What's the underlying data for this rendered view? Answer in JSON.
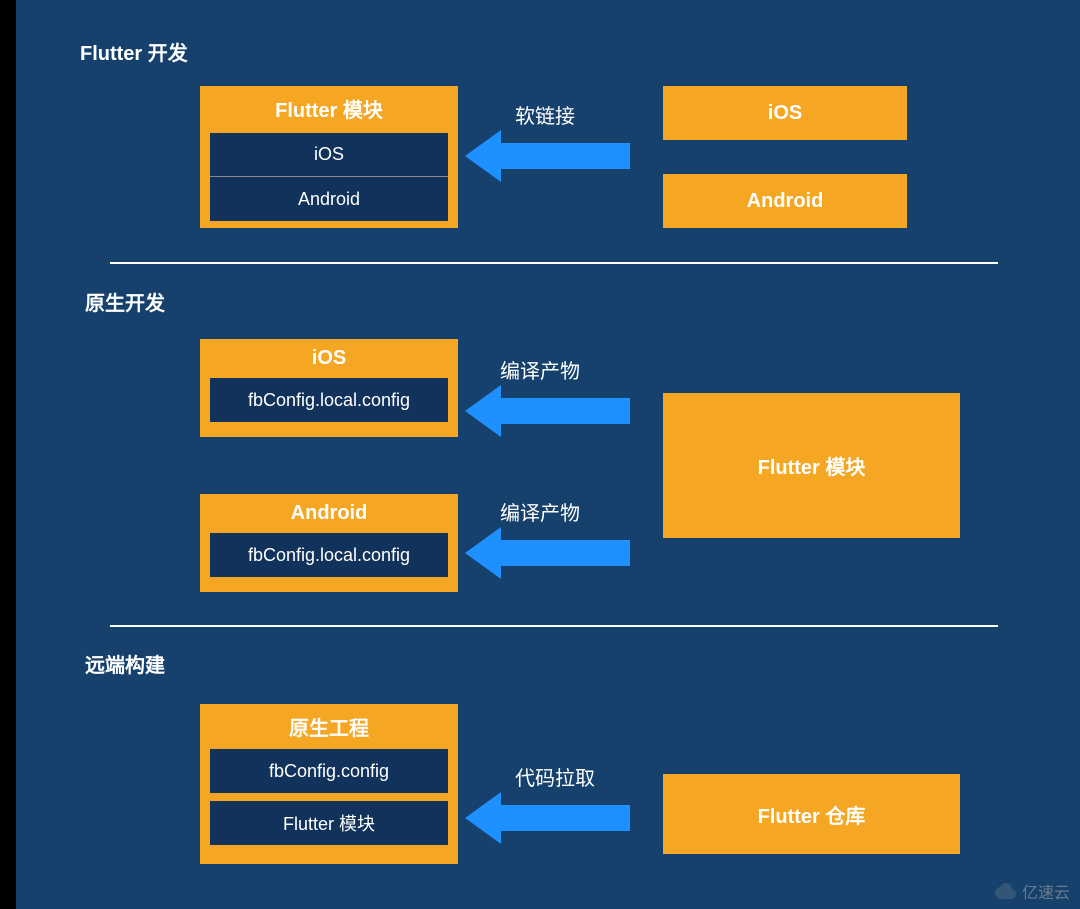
{
  "section1": {
    "title": "Flutter 开发",
    "flutter_module": {
      "title": "Flutter 模块",
      "ios": "iOS",
      "android": "Android"
    },
    "arrow_label": "软链接",
    "ios_box": "iOS",
    "android_box": "Android"
  },
  "section2": {
    "title": "原生开发",
    "ios_box": {
      "title": "iOS",
      "file": "fbConfig.local.config"
    },
    "android_box": {
      "title": "Android",
      "file": "fbConfig.local.config"
    },
    "arrow1_label": "编译产物",
    "arrow2_label": "编译产物",
    "flutter_module": "Flutter 模块"
  },
  "section3": {
    "title": "远端构建",
    "native_box": {
      "title": "原生工程",
      "file1": "fbConfig.config",
      "file2": "Flutter 模块"
    },
    "arrow_label": "代码拉取",
    "flutter_repo": "Flutter 仓库"
  },
  "watermark": "亿速云"
}
